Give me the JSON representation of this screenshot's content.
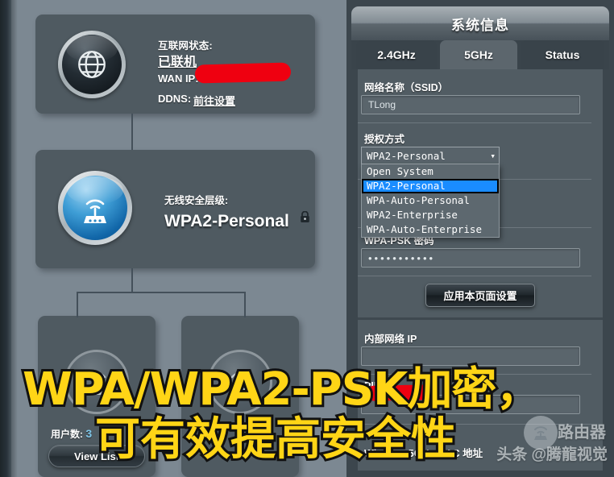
{
  "left": {
    "internet_panel": {
      "icon": "globe-icon",
      "status_label": "互联网状态:",
      "status_value": "已联机",
      "wan_ip_label": "WAN IP:",
      "wan_ip_value": "",
      "ddns_label": "DDNS:",
      "ddns_link": "前往设置"
    },
    "security_panel": {
      "icon": "router-icon",
      "label": "无线安全层级:",
      "value": "WPA2-Personal",
      "lock_icon": "lock-icon"
    },
    "clients_panel": {
      "icon": "client-device-icon",
      "count_label": "用户数:",
      "count_value": "3",
      "view_list_label": "View List"
    }
  },
  "right": {
    "header_title": "系统信息",
    "tabs": [
      {
        "label": "2.4GHz",
        "active": false
      },
      {
        "label": "5GHz",
        "active": true
      },
      {
        "label": "Status",
        "active": false
      }
    ],
    "ssid": {
      "label": "网络名称（SSID）",
      "value": "TLong"
    },
    "auth": {
      "label": "授权方式",
      "selected": "WPA2-Personal",
      "caret_icon": "chevron-down-icon",
      "options": [
        "Open System",
        "WPA2-Personal",
        "WPA-Auto-Personal",
        "WPA2-Enterprise",
        "WPA-Auto-Enterprise"
      ],
      "highlighted_index": 1
    },
    "psk": {
      "label": "WPA-PSK 密码",
      "value": "•••••••••••"
    },
    "apply_button": "应用本页面设置",
    "lan": {
      "label": "内部网络 IP",
      "value": ""
    },
    "pin": {
      "label": "PIN",
      "value": ""
    },
    "mac": {
      "label": "Wireless 5GHz MAC 地址"
    }
  },
  "overlay": {
    "caption_line1": "WPA/WPA2-PSK加密，",
    "caption_line2": "可有效提高安全性",
    "caption_color": "#ffd516",
    "caption_outline": "#111111",
    "redaction_color": "#ef0010"
  },
  "watermarks": {
    "router": "路由器",
    "toutiao": "头条 @腾龍视觉"
  }
}
